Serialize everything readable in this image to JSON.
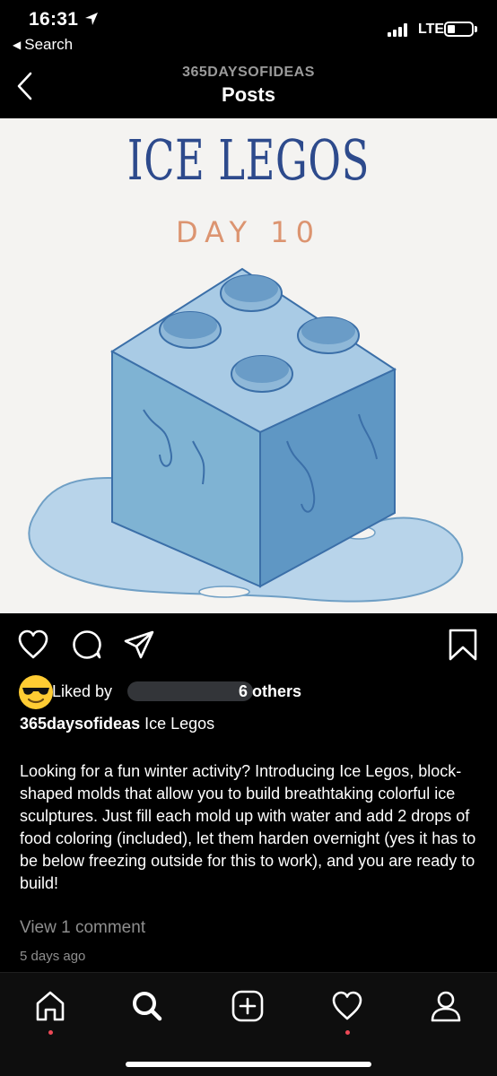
{
  "status_bar": {
    "time": "16:31",
    "back_app": "Search",
    "network": "LTE",
    "icons": [
      "location-arrow-icon",
      "signal-icon",
      "battery-icon"
    ]
  },
  "header": {
    "account": "365DAYSOFIDEAS",
    "title": "Posts"
  },
  "post": {
    "image": {
      "title": "ICE LEGOS",
      "subtitle": "DAY 10",
      "colors": {
        "title": "#2d4a8c",
        "subtitle": "#dc9470",
        "ice": "#7fb3d3"
      }
    },
    "actions": [
      "heart-icon",
      "comment-icon",
      "share-icon",
      "bookmark-icon"
    ],
    "likes": {
      "prefix": "Liked by",
      "suffix": "6 others"
    },
    "caption": {
      "username": "365daysofideas",
      "text": "Ice Legos"
    },
    "body": "Looking for a fun winter activity? Introducing Ice Legos, block-shaped molds that allow you to build breathtaking colorful ice sculptures.  Just fill each mold up with water and add 2 drops of food coloring (included), let them harden overnight (yes it has to be below freezing outside for this to work), and you are ready to build!",
    "view_comments": "View 1 comment",
    "timestamp": "5 days ago"
  },
  "tab_bar": {
    "tabs": [
      "home-icon",
      "search-icon",
      "new-post-icon",
      "activity-icon",
      "profile-icon"
    ],
    "notification_color": "#ed4956"
  }
}
